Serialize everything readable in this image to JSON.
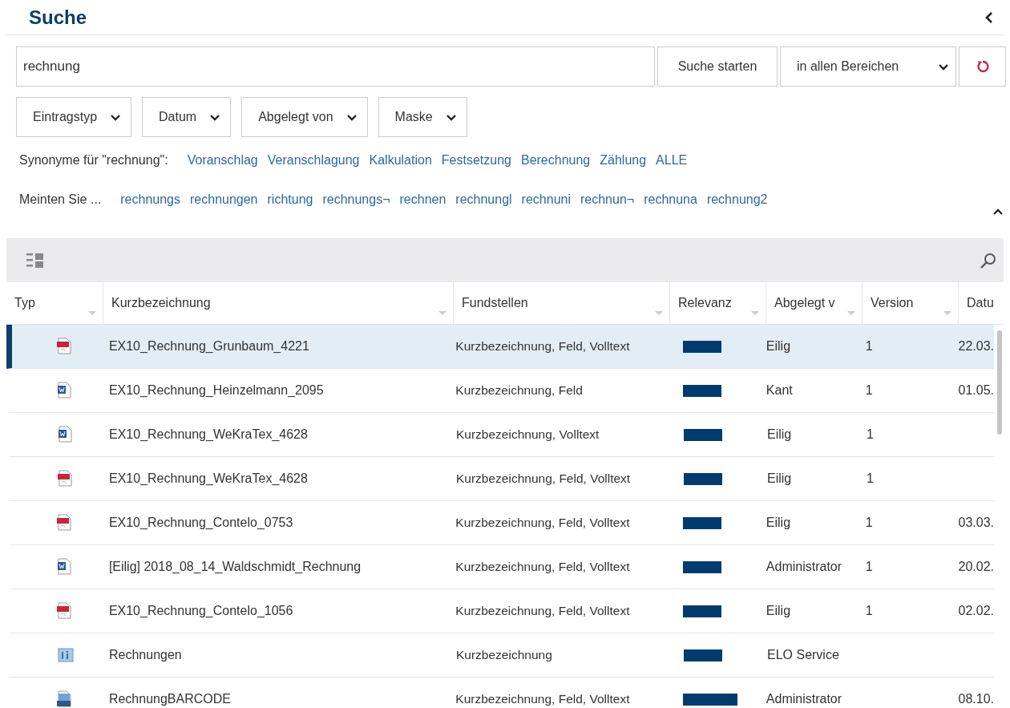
{
  "title": "Suche",
  "search": {
    "value": "rechnung",
    "button": "Suche starten",
    "scope": "in allen Bereichen"
  },
  "filters": [
    {
      "label": "Eintragstyp"
    },
    {
      "label": "Datum"
    },
    {
      "label": "Abgelegt von"
    },
    {
      "label": "Maske"
    }
  ],
  "synonyms": {
    "label": "Synonyme für \"rechnung\":",
    "items": [
      "Voranschlag",
      "Veranschlagung",
      "Kalkulation",
      "Festsetzung",
      "Berechnung",
      "Zählung",
      "ALLE"
    ]
  },
  "suggestions": {
    "label": "Meinten Sie ...",
    "items": [
      "rechnungs",
      "rechnungen",
      "richtung",
      "rechnungs¬",
      "rechnen",
      "rechnungl",
      "rechnuni",
      "rechnun¬",
      "rechnuna",
      "rechnung2"
    ]
  },
  "table": {
    "columns": [
      "Typ",
      "Kurzbezeichnung",
      "Fundstellen",
      "Relevanz",
      "Abgelegt v",
      "Version",
      "Datu"
    ],
    "rows": [
      {
        "kind": "pdf",
        "name": "EX10_Rechnung_Grunbaum_4221",
        "found": "Kurzbezeichnung, Feld, Volltext",
        "top_relevance": false,
        "filed_by": "Eilig",
        "version": "1",
        "date": "22.03.",
        "selected": true
      },
      {
        "kind": "word",
        "name": "EX10_Rechnung_Heinzelmann_2095",
        "found": "Kurzbezeichnung, Feld",
        "top_relevance": false,
        "filed_by": "Kant",
        "version": "1",
        "date": "01.05.",
        "selected": false
      },
      {
        "kind": "word",
        "name": "EX10_Rechnung_WeKraTex_4628",
        "found": "Kurzbezeichnung, Volltext",
        "top_relevance": false,
        "filed_by": "Eilig",
        "version": "1",
        "selected": false
      },
      {
        "kind": "pdf",
        "name": "EX10_Rechnung_WeKraTex_4628",
        "found": "Kurzbezeichnung, Feld, Volltext",
        "top_relevance": false,
        "filed_by": "Eilig",
        "version": "1",
        "selected": false
      },
      {
        "kind": "pdf",
        "name": "EX10_Rechnung_Contelo_0753",
        "found": "Kurzbezeichnung, Feld, Volltext",
        "top_relevance": false,
        "filed_by": "Eilig",
        "version": "1",
        "date": "03.03.",
        "selected": false
      },
      {
        "kind": "word",
        "name": "[Eilig] 2018_08_14_Waldschmidt_Rechnung",
        "found": "Kurzbezeichnung, Feld, Volltext",
        "top_relevance": false,
        "filed_by": "Administrator",
        "version": "1",
        "date": "20.02.",
        "selected": false
      },
      {
        "kind": "pdf",
        "name": "EX10_Rechnung_Contelo_1056",
        "found": "Kurzbezeichnung, Feld, Volltext",
        "top_relevance": false,
        "filed_by": "Eilig",
        "version": "1",
        "date": "02.02.",
        "selected": false
      },
      {
        "kind": "info",
        "name": "Rechnungen",
        "found": "Kurzbezeichnung",
        "top_relevance": false,
        "filed_by": "ELO Service",
        "selected": false
      },
      {
        "kind": "image",
        "name": "RechnungBARCODE",
        "found": "Kurzbezeichnung, Feld, Volltext",
        "top_relevance": true,
        "filed_by": "Administrator",
        "date": "08.10.",
        "selected": false
      }
    ]
  }
}
